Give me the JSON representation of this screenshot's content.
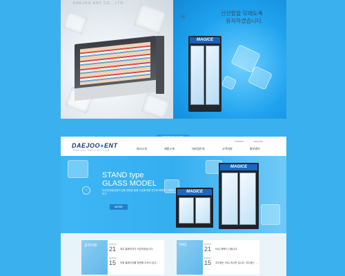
{
  "top_banner": {
    "left_brand": "DAEJOO ENT CO., LTD.",
    "quote_mark": "❝",
    "headline_line1": "신선함을 오래도록",
    "headline_line2": "유지하겠습니다.",
    "fridge_logo": "MAGICE"
  },
  "site": {
    "tab_pill": "PRODUCT NAME",
    "logo_main_a": "DAEJOO",
    "logo_main_dot": "●",
    "logo_main_b": "ENT",
    "logo_sub": "DAEJOO ENT CO., LTD",
    "util_links": [
      "SITEMAP",
      "ENGLISH"
    ],
    "nav": [
      "회사소개",
      "제품소개",
      "대리점안내",
      "고객지원",
      "홍보센터"
    ],
    "hero": {
      "title_line1": "STAND type",
      "title_line2": "GLASS MODEL",
      "desc": "대주엔 응용상품적 유통 제품을 통해 고효율 제품 편안해 폐쇄하고 외형이 안하고",
      "more_label": "MORE",
      "arrow": "‹",
      "fridge_logo_small": "MAGICE",
      "fridge_logo_large": "MAGICE"
    },
    "cards": [
      {
        "title": "공지사항",
        "items": [
          {
            "date": "2015.07",
            "day": "21",
            "text": "대주 홈페이지가 오픈하였습니다."
          },
          {
            "date": "2015.07",
            "day": "15",
            "text": "저희 홈페이지를 방문해 주셔서 감사..."
          }
        ]
      },
      {
        "title": "FAQ",
        "items": [
          {
            "date": "2015.07",
            "day": "21",
            "text": "FAQ 제목이 나옵니다."
          },
          {
            "date": "2015.07",
            "day": "15",
            "text": "자주묻는 FAQ 게시판 입니다. 자주묻는 ..."
          }
        ]
      }
    ]
  },
  "colors": {
    "background": "#3ab0ee",
    "accent": "#1f82c8",
    "navy": "#1a3a6a"
  }
}
